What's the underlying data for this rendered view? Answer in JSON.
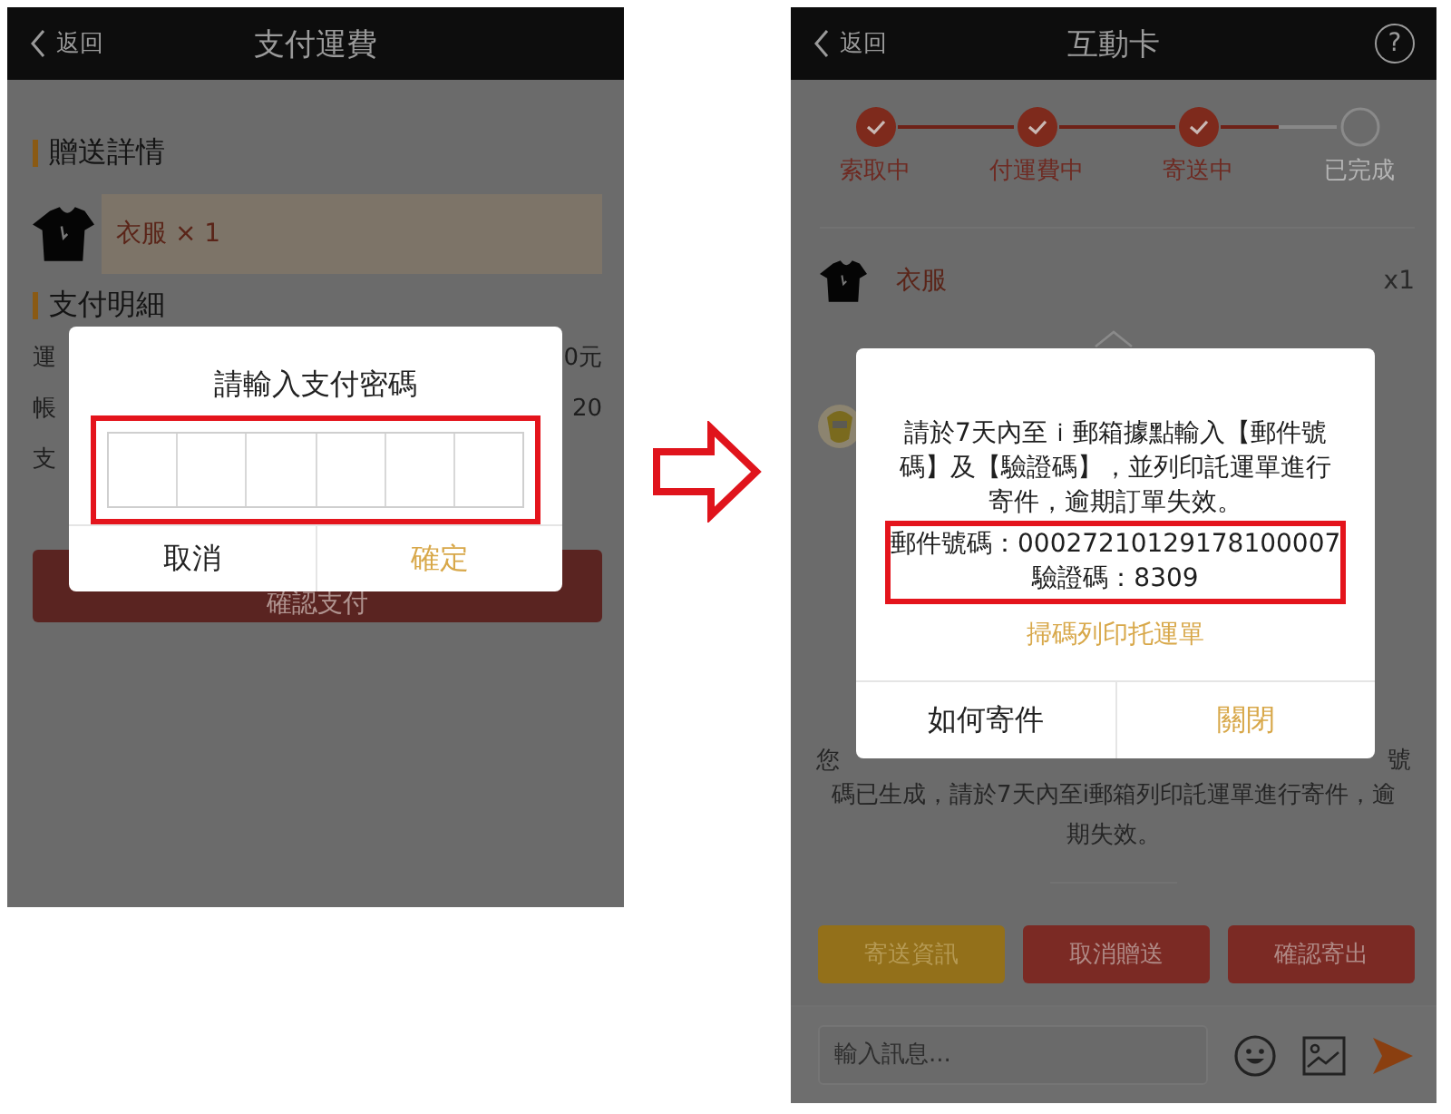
{
  "left_screen": {
    "header": {
      "back": "返回",
      "title": "支付運費"
    },
    "gift_section": {
      "title": "贈送詳情",
      "item": "衣服 × 1"
    },
    "payment_section": {
      "title": "支付明細",
      "rows": [
        {
          "label": "運",
          "value": "0元"
        },
        {
          "label": "帳",
          "value": "20"
        },
        {
          "label": "支"
        }
      ]
    },
    "confirm_button": "確認支付",
    "dialog": {
      "title": "請輸入支付密碼",
      "highlighted": true,
      "buttons": [
        {
          "label": "取消",
          "kind": "cancel"
        },
        {
          "label": "確定",
          "kind": "confirm"
        }
      ]
    }
  },
  "right_screen": {
    "header": {
      "back": "返回",
      "title": "互動卡",
      "help": "?"
    },
    "steps": [
      {
        "label": "索取中",
        "done": true
      },
      {
        "label": "付運費中",
        "done": true
      },
      {
        "label": "寄送中",
        "done": true
      },
      {
        "label": "已完成",
        "done": false
      }
    ],
    "item": {
      "name": "衣服",
      "quantity": "x1"
    },
    "message_fragments": [
      "您",
      "號"
    ],
    "message": "碼已生成，請於7天內至i郵箱列印託運單進行寄件，逾期失效。",
    "actions": [
      {
        "label": "寄送資訊",
        "kind": "info"
      },
      {
        "label": "取消贈送",
        "kind": "cancel"
      },
      {
        "label": "確認寄出",
        "kind": "confirm"
      }
    ],
    "input": {
      "placeholder": "輸入訊息..."
    },
    "dialog": {
      "text": "請於7天內至ｉ郵箱據點輸入【郵件號碼】及【驗證碼】，並列印託運單進行寄件，逾期訂單失效。",
      "highlighted": true,
      "codes": [
        "郵件號碼：00027210129178100007",
        "驗證碼：8309"
      ],
      "link": "掃碼列印托運單",
      "buttons": [
        {
          "label": "如何寄件",
          "kind": "cancel"
        },
        {
          "label": "關閉",
          "kind": "confirm"
        }
      ]
    }
  }
}
